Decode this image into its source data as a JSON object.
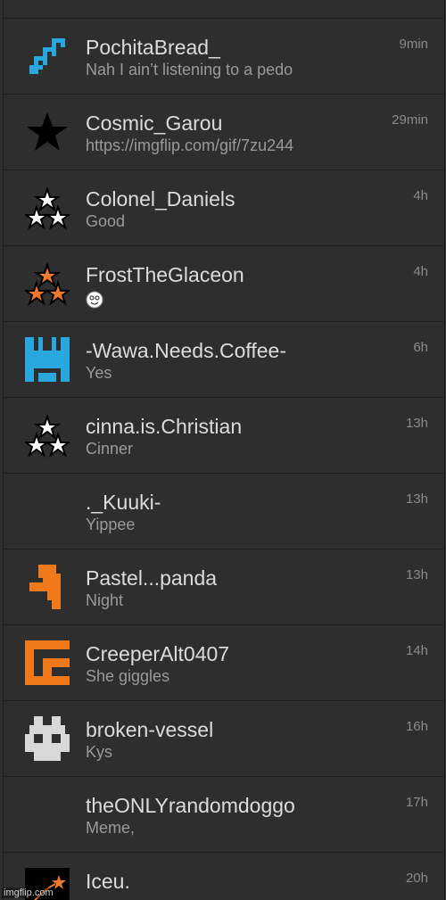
{
  "top_partial_text": "",
  "messages": [
    {
      "username": "PochitaBread_",
      "message": "Nah I ain’t listening to a pedo",
      "time": "9min",
      "avatar_icon": "blue-pixel-diagonal-icon",
      "color": "#29a8e0"
    },
    {
      "username": "Cosmic_Garou",
      "message": "https://imgflip.com/gif/7zu244",
      "time": "29min",
      "avatar_icon": "black-star-icon",
      "color": "#000000"
    },
    {
      "username": "Colonel_Daniels",
      "message": "Good",
      "time": "4h",
      "avatar_icon": "white-three-stars-icon",
      "color": "#ffffff"
    },
    {
      "username": "FrostTheGlaceon",
      "message": "",
      "time": "4h",
      "avatar_icon": "orange-three-stars-icon",
      "color": "#f07a2a"
    },
    {
      "username": "-Wawa.Needs.Coffee-",
      "message": "Yes",
      "time": "6h",
      "avatar_icon": "blue-pixel-h-icon",
      "color": "#29a8e0"
    },
    {
      "username": "cinna.is.Christian",
      "message": "Cinner",
      "time": "13h",
      "avatar_icon": "white-three-stars-icon",
      "color": "#ffffff"
    },
    {
      "username": "._Kuuki-",
      "message": "Yippee",
      "time": "13h",
      "avatar_icon": "",
      "color": ""
    },
    {
      "username": "Pastel...panda",
      "message": "Night",
      "time": "13h",
      "avatar_icon": "orange-pixel-shape-icon",
      "color": "#f07a1a"
    },
    {
      "username": "CreeperAlt0407",
      "message": "She giggles",
      "time": "14h",
      "avatar_icon": "orange-pixel-cc-icon",
      "color": "#f07a1a"
    },
    {
      "username": "broken-vessel",
      "message": "Kys",
      "time": "16h",
      "avatar_icon": "gray-pixel-skull-icon",
      "color": "#d8d8d8"
    },
    {
      "username": "theONLYrandomdoggo",
      "message": "Meme,",
      "time": "17h",
      "avatar_icon": "",
      "color": ""
    },
    {
      "username": "Iceu.",
      "message": "",
      "time": "20h",
      "avatar_icon": "shooting-star-icon",
      "color": "#f07a2a"
    }
  ],
  "watermark": "imgflip.com"
}
